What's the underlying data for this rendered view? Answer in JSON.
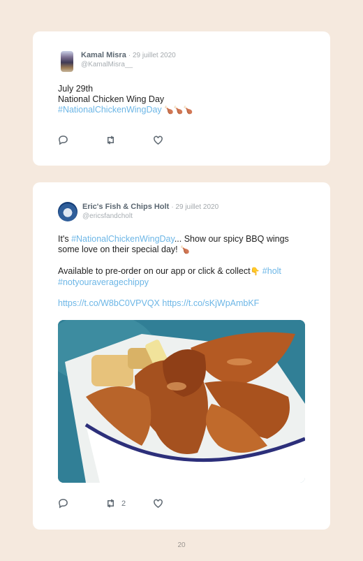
{
  "tweets": [
    {
      "name": "Kamal Misra",
      "date": "· 29 juillet 2020",
      "handle": "@KamalMisra__",
      "lines": [
        "July 29th",
        "National Chicken Wing Day"
      ],
      "hashtag": "#NationalChickenWingDay",
      "emojis": "🍗🍗🍗",
      "actions": {
        "reply_icon": "reply-icon",
        "retweet_icon": "retweet-icon",
        "like_icon": "like-icon"
      }
    },
    {
      "name": "Eric's Fish & Chips Holt",
      "date": "· 29 juillet 2020",
      "handle": "@ericsfandcholt",
      "p1_pre": "It's ",
      "p1_hashtag": "#NationalChickenWingDay",
      "p1_post": "... Show our spicy BBQ wings some love on their special day! ",
      "p1_emoji": "🍗",
      "p2_text": "Available to pre-order on our app or click & collect",
      "p2_emoji": "👇",
      "p2_hashtag1": "#holt",
      "p2_hashtag2": "#notyouraveragechippy",
      "link1": "https://t.co/W8bC0VPVQX",
      "link2": "https://t.co/sKjWpAmbKF",
      "retweet_count": "2",
      "actions": {
        "reply_icon": "reply-icon",
        "retweet_icon": "retweet-icon",
        "like_icon": "like-icon"
      }
    }
  ],
  "page_number": "20"
}
